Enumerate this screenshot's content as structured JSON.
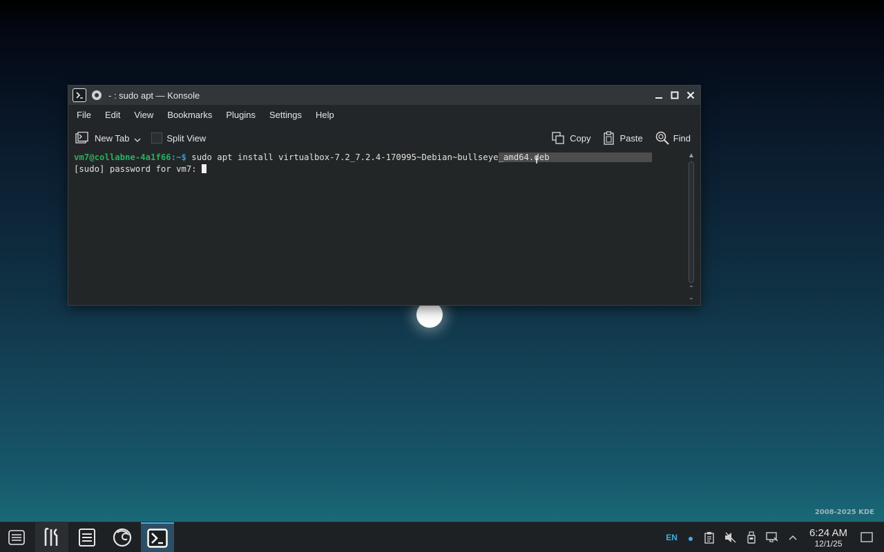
{
  "window": {
    "title": "- : sudo apt — Konsole"
  },
  "menubar": {
    "items": [
      "File",
      "Edit",
      "View",
      "Bookmarks",
      "Plugins",
      "Settings",
      "Help"
    ]
  },
  "toolbar": {
    "new_tab": "New Tab",
    "split_view": "Split View",
    "copy": "Copy",
    "paste": "Paste",
    "find": "Find"
  },
  "terminal": {
    "prompt_user": "vm7@collabne-4a1f66",
    "prompt_path": ":~$",
    "command_before_selection": " sudo apt install virtualbox-7.2_7.2.4-170995~Debian~bullseye",
    "command_selected": "_amd64.deb",
    "password_prompt": "[sudo] password for vm7: "
  },
  "desktop": {
    "copyright": "2008-2025 KDE"
  },
  "taskbar": {
    "language": "EN",
    "time": "6:24 AM",
    "date": "12/1/25"
  },
  "colors": {
    "accent": "#3daee9",
    "prompt_user": "#27ae60",
    "prompt_path": "#2a9fd6"
  }
}
